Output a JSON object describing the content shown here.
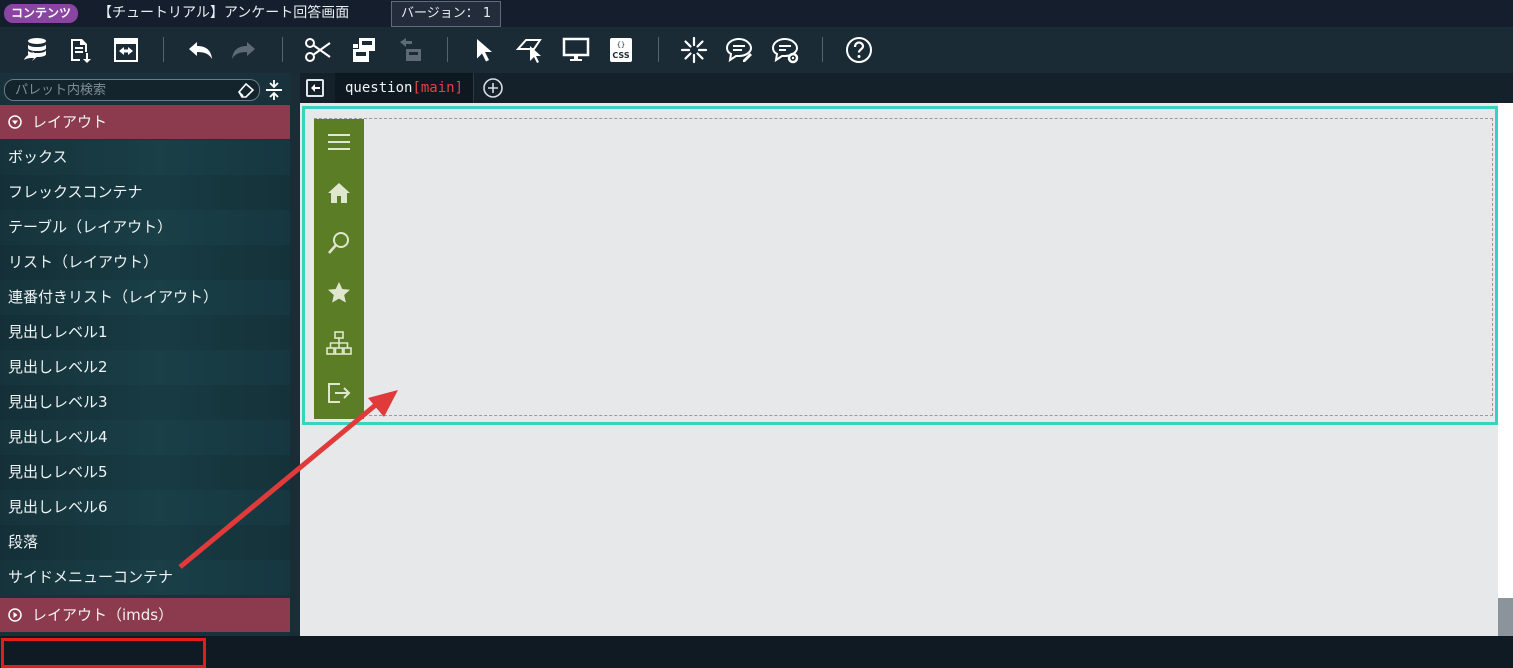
{
  "title_bar": {
    "badge": "コンテンツ",
    "title": "【チュートリアル】アンケート回答画面",
    "version": "バージョン： 1"
  },
  "toolbar": {
    "icons": [
      "database-icon",
      "document-export-icon",
      "swap-icon",
      "undo-icon",
      "redo-icon",
      "cut-icon",
      "copy-component-icon",
      "paste-component-icon",
      "select-pointer-icon",
      "select-parent-icon",
      "preview-monitor-icon",
      "css-icon",
      "sparkle-icon",
      "comment-edit-icon",
      "comment-settings-icon",
      "help-icon"
    ]
  },
  "palette": {
    "search_placeholder": "パレット内検索",
    "category_layout": "レイアウト",
    "items": [
      "ボックス",
      "フレックスコンテナ",
      "テーブル（レイアウト）",
      "リスト（レイアウト）",
      "連番付きリスト（レイアウト）",
      "見出しレベル1",
      "見出しレベル2",
      "見出しレベル3",
      "見出しレベル4",
      "見出しレベル5",
      "見出しレベル6",
      "段落",
      "サイドメニューコンテナ"
    ],
    "category_layout_imds": "レイアウト（imds）"
  },
  "editor": {
    "tab_name": "question",
    "tab_sub": "[main]"
  },
  "side_menu": {
    "icons": [
      "menu-icon",
      "home-icon",
      "search-icon",
      "star-icon",
      "sitemap-icon",
      "logout-icon"
    ],
    "color": "#5b7d26"
  },
  "colors": {
    "accent_badge": "#8a44a2",
    "category": "#8c3a4e",
    "selection": "#35d3c0",
    "annotation": "#e21d1d"
  }
}
